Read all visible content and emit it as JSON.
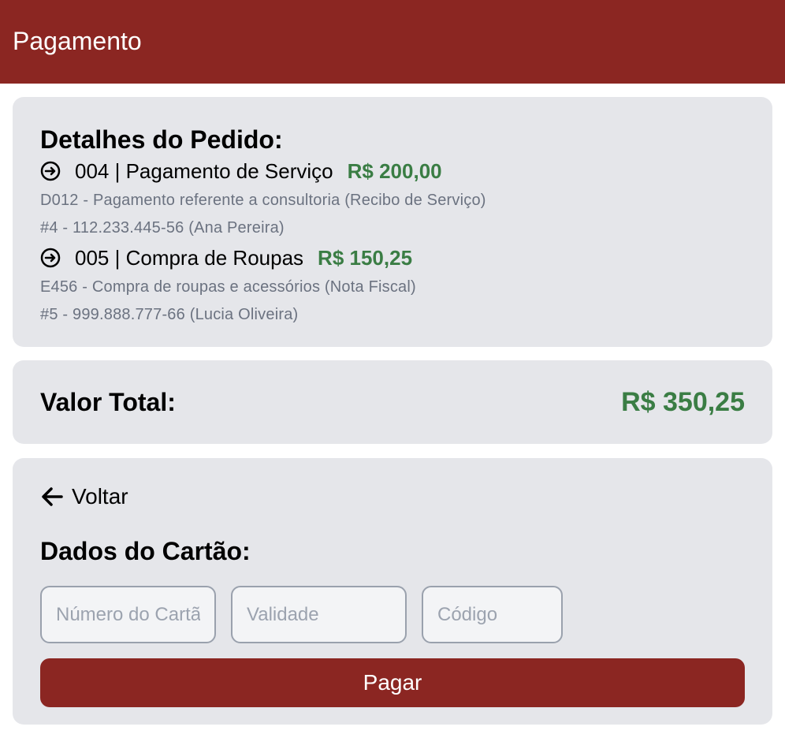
{
  "header": {
    "title": "Pagamento"
  },
  "order": {
    "title": "Detalhes do Pedido:",
    "items": [
      {
        "icon": "arrow-circle-right-icon",
        "title": "004 | Pagamento de Serviço",
        "price": "R$ 200,00",
        "description": "D012 - Pagamento referente a consultoria (Recibo de Serviço)",
        "client": "#4 - 112.233.445-56 (Ana Pereira)"
      },
      {
        "icon": "arrow-circle-right-icon",
        "title": "005 | Compra de Roupas",
        "price": "R$ 150,25",
        "description": "E456 - Compra de roupas e acessórios (Nota Fiscal)",
        "client": "#5 - 999.888.777-66 (Lucia Oliveira)"
      }
    ]
  },
  "total": {
    "label": "Valor Total:",
    "value": "R$ 350,25"
  },
  "payment": {
    "back_label": "Voltar",
    "back_icon": "arrow-left-icon",
    "title": "Dados do Cartão:",
    "fields": {
      "number_placeholder": "Número do Cartão",
      "validity_placeholder": "Validade",
      "code_placeholder": "Código",
      "number_value": "",
      "validity_value": "",
      "code_value": ""
    },
    "submit_label": "Pagar"
  },
  "colors": {
    "header_bg": "#8b2622",
    "card_bg": "#e5e6ea",
    "price_green": "#3a7d44",
    "muted_text": "#6b7280"
  }
}
